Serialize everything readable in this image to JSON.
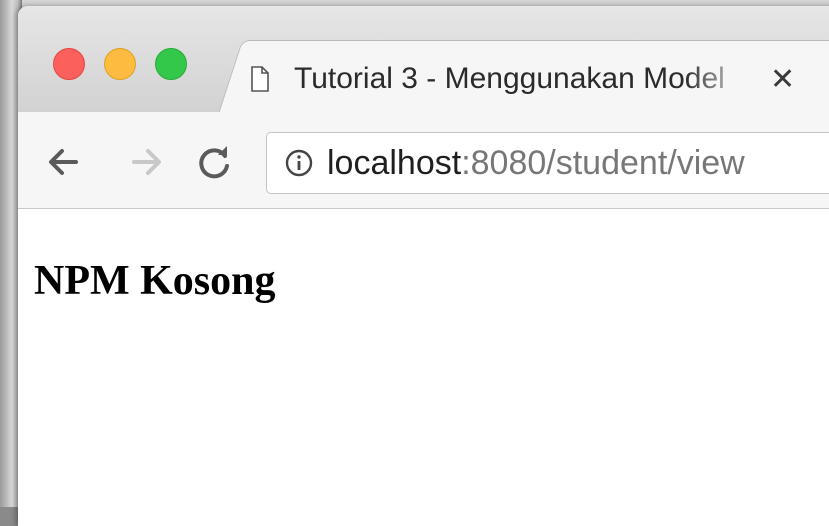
{
  "browser": {
    "tab": {
      "title": "Tutorial 3 - Menggunakan Model",
      "close_glyph": "✕"
    },
    "address_bar": {
      "host": "localhost",
      "rest": ":8080/student/view"
    },
    "nav_icons": {
      "back": "arrow-left-icon",
      "forward": "arrow-right-icon",
      "reload": "reload-icon"
    },
    "colors": {
      "close": "#fc605c",
      "minimize": "#fdbc40",
      "maximize": "#34c84a"
    }
  },
  "page": {
    "heading": "NPM Kosong"
  }
}
